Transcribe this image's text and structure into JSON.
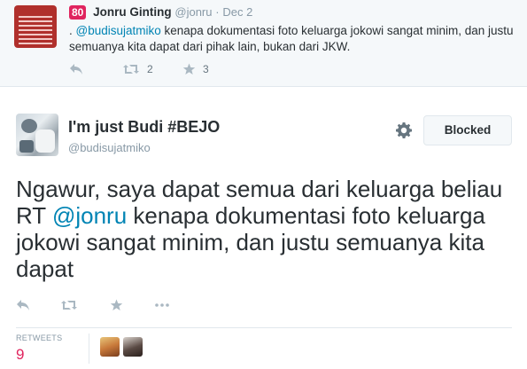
{
  "previous_tweet": {
    "score": "80",
    "name": "Jonru Ginting",
    "handle": "@jonru",
    "separator": "·",
    "date": "Dec 2",
    "text_prefix": ". ",
    "mention": "@budisujatmiko",
    "text_rest": " kenapa dokumentasi foto keluarga jokowi sangat minim, dan justu semuanya kita dapat dari pihak lain, bukan dari JKW.",
    "retweet_count": "2",
    "favorite_count": "3"
  },
  "main_tweet": {
    "name": "I'm just Budi #BEJO",
    "handle": "@budisujatmiko",
    "blocked_label": "Blocked",
    "text_before": "Ngawur, saya dapat semua dari keluarga beliau RT ",
    "mention": "@jonru",
    "text_after": " kenapa dokumentasi foto keluarga jokowi sangat minim, dan justu semuanya kita dapat",
    "retweets_label": "RETWEETS",
    "retweets_value": "9"
  },
  "icons": {
    "reply": "reply-icon",
    "retweet": "retweet-icon",
    "favorite": "star-icon",
    "more": "more-icon",
    "settings": "gear-icon"
  },
  "colors": {
    "link": "#0084b4",
    "score_badge": "#e0245e",
    "retweets_value": "#e0245e",
    "muted": "#8899a6"
  }
}
